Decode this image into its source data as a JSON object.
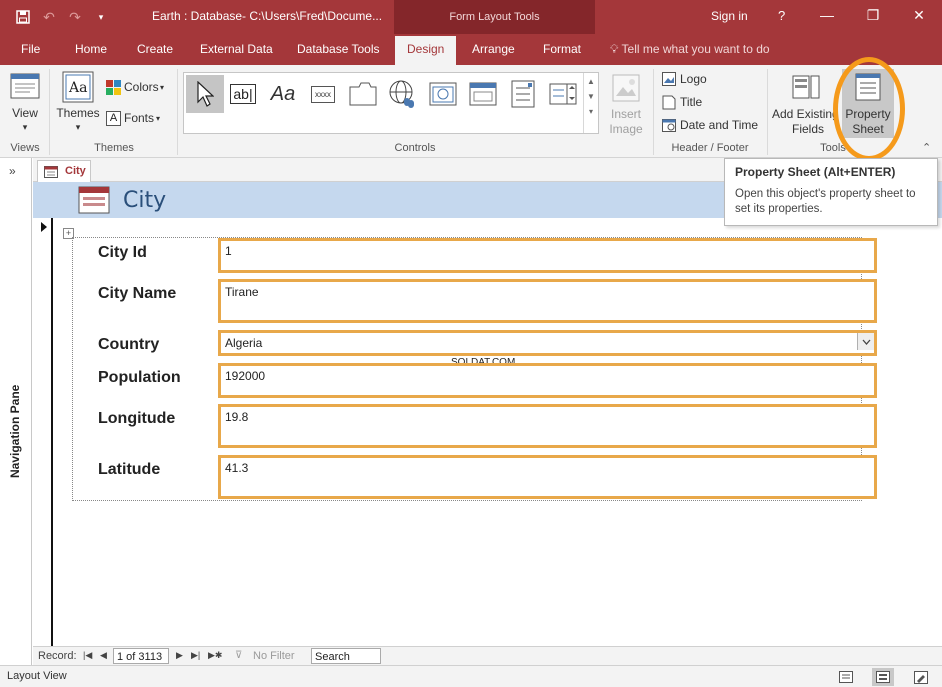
{
  "titlebar": {
    "document_title": "Earth : Database- C:\\Users\\Fred\\Docume...",
    "context_tab": "Form Layout Tools",
    "sign_in": "Sign in",
    "help": "?"
  },
  "tabs": [
    {
      "label": "File"
    },
    {
      "label": "Home"
    },
    {
      "label": "Create"
    },
    {
      "label": "External Data"
    },
    {
      "label": "Database Tools"
    },
    {
      "label": "Design"
    },
    {
      "label": "Arrange"
    },
    {
      "label": "Format"
    }
  ],
  "tell_me": "Tell me what you want to do",
  "ribbon": {
    "views": {
      "view_label": "View",
      "group": "Views"
    },
    "themes": {
      "themes_label": "Themes",
      "colors_label": "Colors",
      "fonts_label": "Fonts",
      "group": "Themes"
    },
    "controls": {
      "group": "Controls",
      "insert_image_line1": "Insert",
      "insert_image_line2": "Image",
      "textbox_glyph": "ab|",
      "label_glyph": "Aa",
      "button_glyph": "xxxx"
    },
    "header_footer": {
      "logo": "Logo",
      "title": "Title",
      "date_time": "Date and Time",
      "group": "Header / Footer"
    },
    "tools": {
      "add_existing_line1": "Add Existing",
      "add_existing_line2": "Fields",
      "property_sheet_line1": "Property",
      "property_sheet_line2": "Sheet",
      "group": "Tools"
    }
  },
  "doc_tab": {
    "label": "City"
  },
  "form": {
    "title": "City",
    "fields": [
      {
        "label": "City Id",
        "value": "1"
      },
      {
        "label": "City Name",
        "value": "Tirane"
      },
      {
        "label": "Country",
        "value": "Algeria"
      },
      {
        "label": "Population",
        "value": "192000"
      },
      {
        "label": "Longitude",
        "value": "19.8"
      },
      {
        "label": "Latitude",
        "value": "41.3"
      }
    ],
    "watermark": "SQLDAT.COM"
  },
  "record_nav": {
    "record_label": "Record:",
    "position": "1 of 3113",
    "no_filter": "No Filter",
    "search": "Search"
  },
  "statusbar": {
    "mode": "Layout View"
  },
  "nav_pane": {
    "label": "Navigation Pane"
  },
  "tooltip": {
    "title": "Property Sheet (Alt+ENTER)",
    "description": "Open this object's property sheet to set its properties."
  },
  "colors": {
    "accent": "#a4373a",
    "field_border": "#e8a84a",
    "highlight": "#f59a1b",
    "header_band": "#c5d8ee"
  }
}
